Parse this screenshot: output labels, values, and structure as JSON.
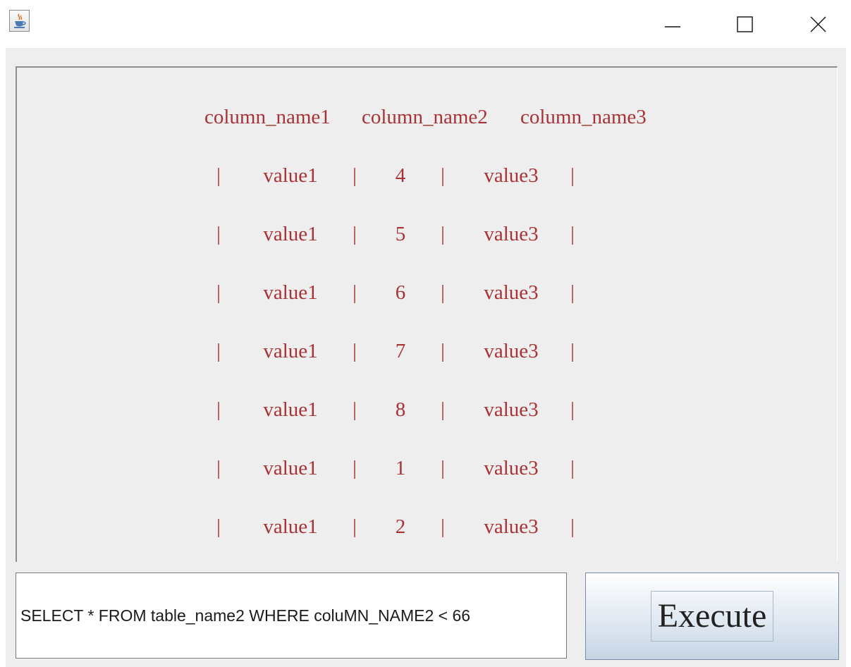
{
  "window": {
    "app_icon": "java-coffee-icon",
    "controls": [
      "minimize-icon",
      "maximize-icon",
      "close-icon"
    ]
  },
  "results": {
    "headers": [
      "column_name1",
      "column_name2",
      "column_name3"
    ],
    "separator": "|",
    "rows": [
      [
        "value1",
        "4",
        "value3"
      ],
      [
        "value1",
        "5",
        "value3"
      ],
      [
        "value1",
        "6",
        "value3"
      ],
      [
        "value1",
        "7",
        "value3"
      ],
      [
        "value1",
        "8",
        "value3"
      ],
      [
        "value1",
        "1",
        "value3"
      ],
      [
        "value1",
        "2",
        "value3"
      ]
    ],
    "text_color": "#a83236"
  },
  "query": {
    "value": "SELECT * FROM table_name2 WHERE coluMN_NAME2 < 66"
  },
  "execute_button": {
    "label": "Execute"
  }
}
